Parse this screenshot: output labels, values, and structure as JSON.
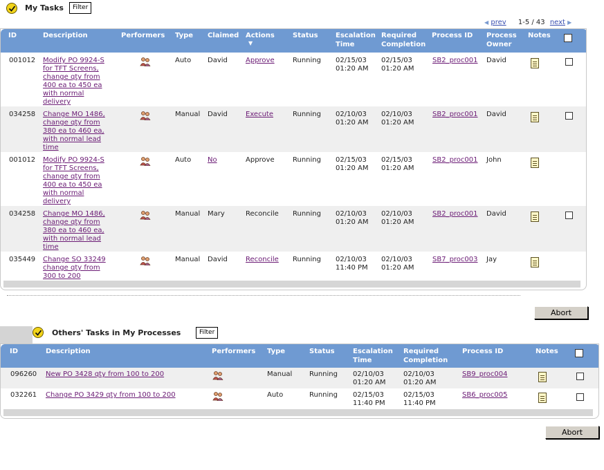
{
  "my_tasks": {
    "title": "My Tasks",
    "filter_label": "Filter",
    "pager": {
      "prev": "prev",
      "range": "1-5 / 43",
      "next": "next"
    },
    "columns": {
      "id": "ID",
      "description": "Description",
      "performers": "Performers",
      "type": "Type",
      "claimed": "Claimed",
      "actions": "Actions",
      "status": "Status",
      "escalation_1": "Escalation",
      "escalation_2": "Time",
      "required_1": "Required",
      "required_2": "Completion",
      "process_id": "Process ID",
      "owner_1": "Process",
      "owner_2": "Owner",
      "notes": "Notes"
    },
    "rows": [
      {
        "id": "001012",
        "desc": [
          "Modify PO 9924-S",
          "for TFT Screens,",
          "change qty from",
          "400 ea to 450 ea",
          "with normal",
          "delivery"
        ],
        "type": "Auto",
        "claimed": "David",
        "action": "Approve",
        "status": "Running",
        "esc_date": "02/15/03",
        "esc_time": "01:20 AM",
        "req_date": "02/15/03",
        "req_time": "01:20 AM",
        "process_id": "SB2_proc001",
        "owner": "David"
      },
      {
        "id": "034258",
        "desc": [
          "Change MO 1486,",
          "change qty from",
          "380 ea to 460 ea,",
          "with normal lead",
          "time"
        ],
        "type": "Manual",
        "claimed": "David",
        "action": "Execute",
        "status": "Running",
        "esc_date": "02/10/03",
        "esc_time": "01:20 AM",
        "req_date": "02/10/03",
        "req_time": "01:20 AM",
        "process_id": "SB2_proc001",
        "owner": "David"
      },
      {
        "id": "001012",
        "desc": [
          "Modify PO 9924-S",
          "for TFT Screens,",
          "change qty from",
          "400 ea to 450 ea",
          "with normal",
          "delivery"
        ],
        "type": "Auto",
        "claimed": "No",
        "action": "Approve",
        "status": "Running",
        "esc_date": "02/15/03",
        "esc_time": "01:20 AM",
        "req_date": "02/15/03",
        "req_time": "01:20 AM",
        "process_id": "SB2_proc001",
        "owner": "John"
      },
      {
        "id": "034258",
        "desc": [
          "Change MO 1486,",
          "change qty from",
          "380 ea to 460 ea,",
          "with normal lead",
          "time"
        ],
        "type": "Manual",
        "claimed": "Mary",
        "action": "Reconcile",
        "status": "Running",
        "esc_date": "02/10/03",
        "esc_time": "01:20 AM",
        "req_date": "02/10/03",
        "req_time": "01:20 AM",
        "process_id": "SB2_proc001",
        "owner": "David"
      },
      {
        "id": "035449",
        "desc": [
          "Change SO 33249",
          "change qty from",
          "300 to 200"
        ],
        "type": "Manual",
        "claimed": "David",
        "action": "Reconcile",
        "status": "Running",
        "esc_date": "02/10/03",
        "esc_time": "11:40 PM",
        "req_date": "02/10/03",
        "req_time": "01:20 AM",
        "process_id": "SB7_proc003",
        "owner": "Jay"
      }
    ],
    "abort_label": "Abort"
  },
  "others_tasks": {
    "title": "Others' Tasks in My Processes",
    "filter_label": "Filter",
    "columns": {
      "id": "ID",
      "description": "Description",
      "performers": "Performers",
      "type": "Type",
      "status": "Status",
      "escalation_1": "Escalation",
      "escalation_2": "Time",
      "required_1": "Required",
      "required_2": "Completion",
      "process_id": "Process ID",
      "notes": "Notes"
    },
    "rows": [
      {
        "id": "096260",
        "desc": "New PO 3428 qty from 100 to 200",
        "type": "Manual",
        "status": "Running",
        "esc_date": "02/10/03",
        "esc_time": "01:20 AM",
        "req_date": "02/10/03",
        "req_time": "01:20 AM",
        "process_id": "SB9_proc004"
      },
      {
        "id": "032261",
        "desc": "Change PO 3429 qty from 100 to 200",
        "type": "Auto",
        "status": "Running",
        "esc_date": "02/15/03",
        "esc_time": "11:40 PM",
        "req_date": "02/15/03",
        "req_time": "11:40 PM",
        "process_id": "SB6_proc005"
      }
    ],
    "abort_label": "Abort"
  },
  "icons": {
    "section": "check-circle-icon",
    "performers": "people-icon",
    "notes": "note-icon"
  },
  "colors": {
    "header_bg": "#6f9ad2",
    "link": "#6a1a74",
    "alt_row": "#efefef"
  }
}
